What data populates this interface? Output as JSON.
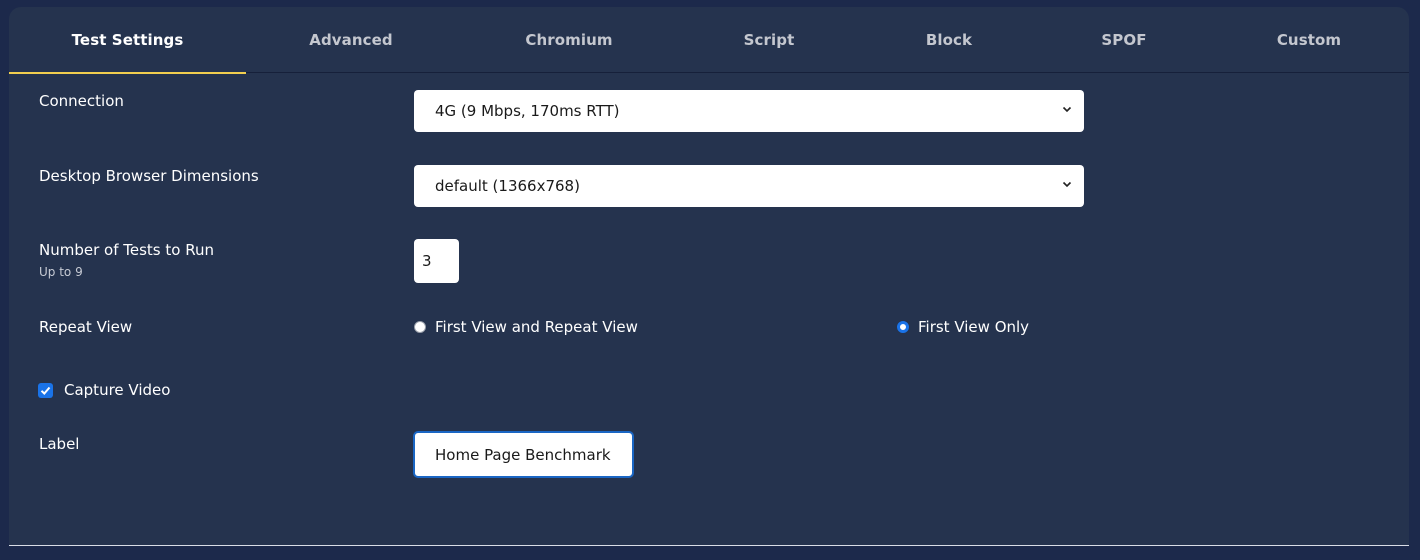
{
  "tabs": [
    {
      "label": "Test Settings",
      "active": true
    },
    {
      "label": "Advanced",
      "active": false
    },
    {
      "label": "Chromium",
      "active": false
    },
    {
      "label": "Script",
      "active": false
    },
    {
      "label": "Block",
      "active": false
    },
    {
      "label": "SPOF",
      "active": false
    },
    {
      "label": "Custom",
      "active": false
    }
  ],
  "form": {
    "connection": {
      "label": "Connection",
      "value": "4G (9 Mbps, 170ms RTT)"
    },
    "dimensions": {
      "label": "Desktop Browser Dimensions",
      "value": "default (1366x768)"
    },
    "num_tests": {
      "label": "Number of Tests to Run",
      "hint": "Up to 9",
      "value": "3"
    },
    "repeat_view": {
      "label": "Repeat View",
      "options": [
        {
          "label": "First View and Repeat View",
          "checked": false
        },
        {
          "label": "First View Only",
          "checked": true
        }
      ]
    },
    "capture_video": {
      "label": "Capture Video",
      "checked": true
    },
    "test_label": {
      "label": "Label",
      "value": "Home Page Benchmark"
    }
  },
  "colors": {
    "accent": "#f2cf4f",
    "primary": "#1a73e8",
    "panel": "#25334e",
    "background": "#1c294b"
  }
}
